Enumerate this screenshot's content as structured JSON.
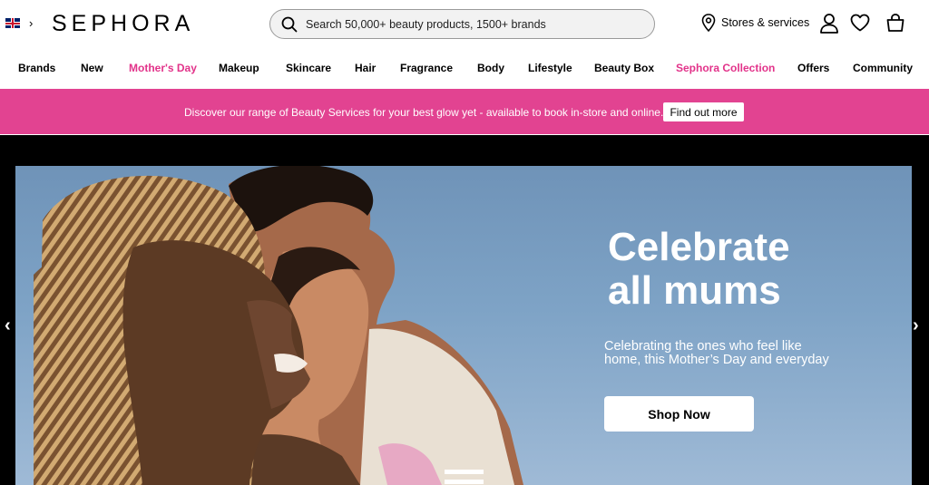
{
  "header": {
    "brand": "SEPHORA",
    "search_placeholder": "Search 50,000+ beauty products, 1500+ brands",
    "stores_label": "Stores & services"
  },
  "nav": {
    "items": [
      {
        "label": "Brands",
        "highlight": false
      },
      {
        "label": "New",
        "highlight": false
      },
      {
        "label": "Mother's Day",
        "highlight": true
      },
      {
        "label": "Makeup",
        "highlight": false
      },
      {
        "label": "Skincare",
        "highlight": false
      },
      {
        "label": "Hair",
        "highlight": false
      },
      {
        "label": "Fragrance",
        "highlight": false
      },
      {
        "label": "Body",
        "highlight": false
      },
      {
        "label": "Lifestyle",
        "highlight": false
      },
      {
        "label": "Beauty Box",
        "highlight": false
      },
      {
        "label": "Sephora Collection",
        "highlight": true
      },
      {
        "label": "Offers",
        "highlight": false
      },
      {
        "label": "Community",
        "highlight": false
      }
    ]
  },
  "banner": {
    "text": "Discover our range of Beauty Services for your best glow yet - available to book in-store and online.",
    "button_label": "Find out more"
  },
  "hero": {
    "title_line1": "Celebrate",
    "title_line2": "all mums",
    "subtitle": "Celebrating the ones who feel like home, this Mother’s Day and everyday",
    "cta_label": "Shop Now",
    "prev_arrow": "‹",
    "next_arrow": "›"
  },
  "icons": {
    "flag": "uk-flag-icon",
    "locale_chevron": "chevron-right-icon",
    "search": "search-icon",
    "location": "location-pin-icon",
    "account": "user-icon",
    "wishlist": "heart-icon",
    "basket": "basket-icon"
  },
  "colors": {
    "accent_pink": "#e2338a",
    "banner_pink": "#e24391",
    "hero_sky": "#7ea3c6"
  }
}
